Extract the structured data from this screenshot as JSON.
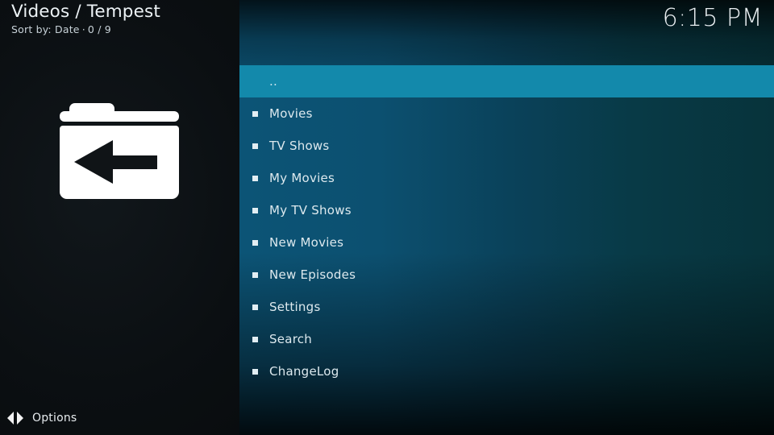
{
  "header": {
    "title": "Videos / Tempest",
    "sort_label": "Sort by: Date",
    "separator": "·",
    "count": "0 / 9",
    "folder_icon": "folder-back-icon"
  },
  "clock": {
    "time": "6:15 PM"
  },
  "footer": {
    "options_label": "Options",
    "options_icon": "left-right-arrows-icon"
  },
  "list": {
    "items": [
      {
        "label": "..",
        "selected": true,
        "bullet": false
      },
      {
        "label": "Movies",
        "selected": false,
        "bullet": true
      },
      {
        "label": "TV Shows",
        "selected": false,
        "bullet": true
      },
      {
        "label": "My Movies",
        "selected": false,
        "bullet": true
      },
      {
        "label": "My TV Shows",
        "selected": false,
        "bullet": true
      },
      {
        "label": "New Movies",
        "selected": false,
        "bullet": true
      },
      {
        "label": "New Episodes",
        "selected": false,
        "bullet": true
      },
      {
        "label": "Settings",
        "selected": false,
        "bullet": true
      },
      {
        "label": "Search",
        "selected": false,
        "bullet": true
      },
      {
        "label": "ChangeLog",
        "selected": false,
        "bullet": true
      }
    ]
  },
  "colors": {
    "highlight": "#1389ab",
    "panel_background_left": "#0c1013",
    "text_primary": "#dde9ee",
    "accent_icon": "#ffffff"
  }
}
